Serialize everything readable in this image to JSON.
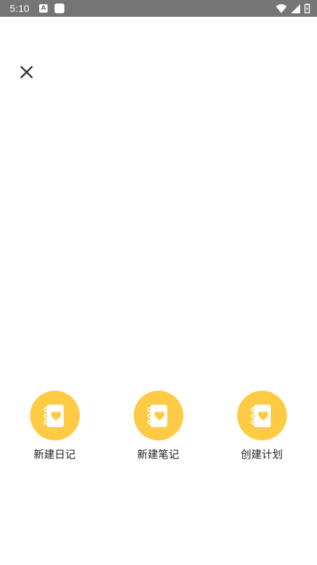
{
  "status_bar": {
    "time": "5:10",
    "notification_letter": "A",
    "icons": [
      "wifi-icon",
      "signal-icon",
      "battery-icon"
    ]
  },
  "close": {
    "icon": "close-icon"
  },
  "actions": [
    {
      "label": "新建日记",
      "icon": "notebook-heart-icon"
    },
    {
      "label": "新建笔记",
      "icon": "notebook-heart-icon"
    },
    {
      "label": "创建计划",
      "icon": "notebook-heart-icon"
    }
  ],
  "colors": {
    "status_bar": "#757575",
    "accent": "#ffcb45",
    "background": "#ffffff",
    "text": "#222222"
  }
}
